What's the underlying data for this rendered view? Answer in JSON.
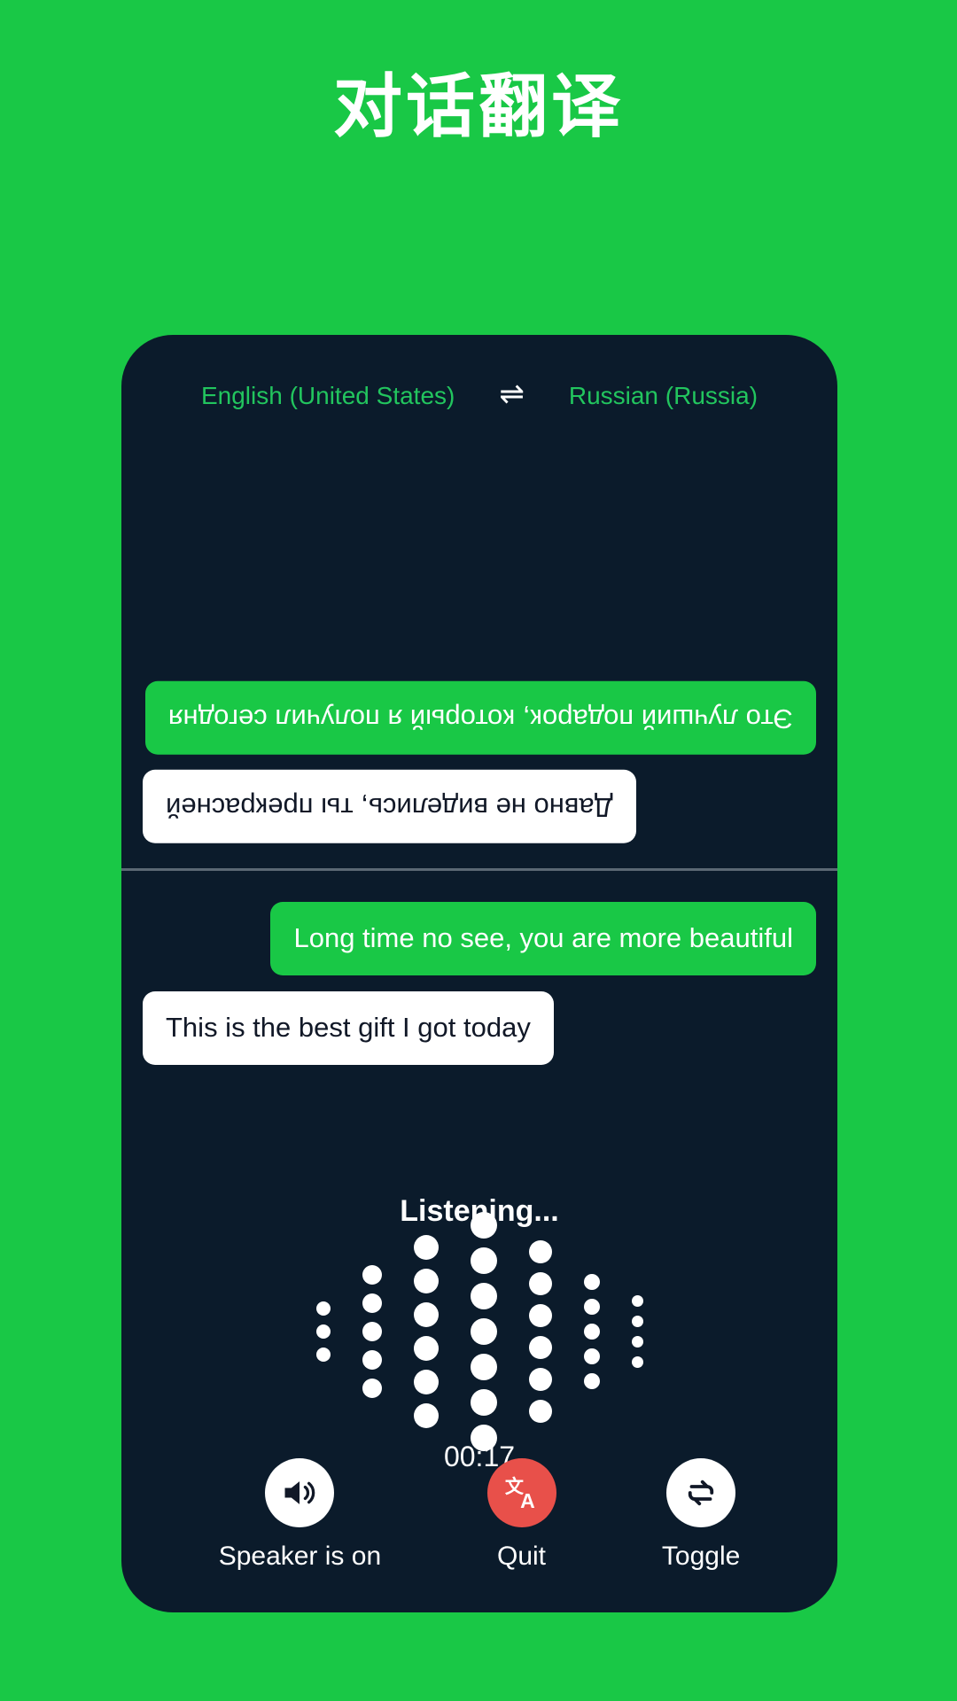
{
  "page": {
    "title": "对话翻译",
    "background_color": "#19c846"
  },
  "phone": {
    "panel_color": "#0b1b2b",
    "language_bar": {
      "source_language": "English (United States)",
      "swap_icon": "swap-horizontal-icon",
      "swap_glyph": "⇌",
      "target_language": "Russian (Russia)",
      "accent_color": "#22c55e"
    },
    "conversation": {
      "remote_messages": [
        {
          "text": "Это лучший подарок, который я получил сегодня",
          "style": "green",
          "align": "left"
        },
        {
          "text": "Давно не виделись, ты прекрасней",
          "style": "white",
          "align": "right"
        }
      ],
      "local_messages": [
        {
          "text": "Long time no see, you are more beautiful",
          "style": "green",
          "align": "right"
        },
        {
          "text": "This is the best gift I got today",
          "style": "white",
          "align": "left"
        }
      ]
    },
    "recording": {
      "status_label": "Listening...",
      "timer": "00:17",
      "waveform_columns": [
        3,
        5,
        6,
        7,
        6,
        5,
        4
      ],
      "waveform_dot_sizes": [
        16,
        22,
        28,
        30,
        26,
        18,
        13
      ]
    },
    "controls": [
      {
        "label": "Speaker is on",
        "icon": "speaker-on-icon",
        "style": "light"
      },
      {
        "label": "Quit",
        "icon": "translate-icon",
        "style": "danger",
        "color": "#e8504a"
      },
      {
        "label": "Toggle",
        "icon": "toggle-swap-icon",
        "style": "light"
      }
    ]
  }
}
